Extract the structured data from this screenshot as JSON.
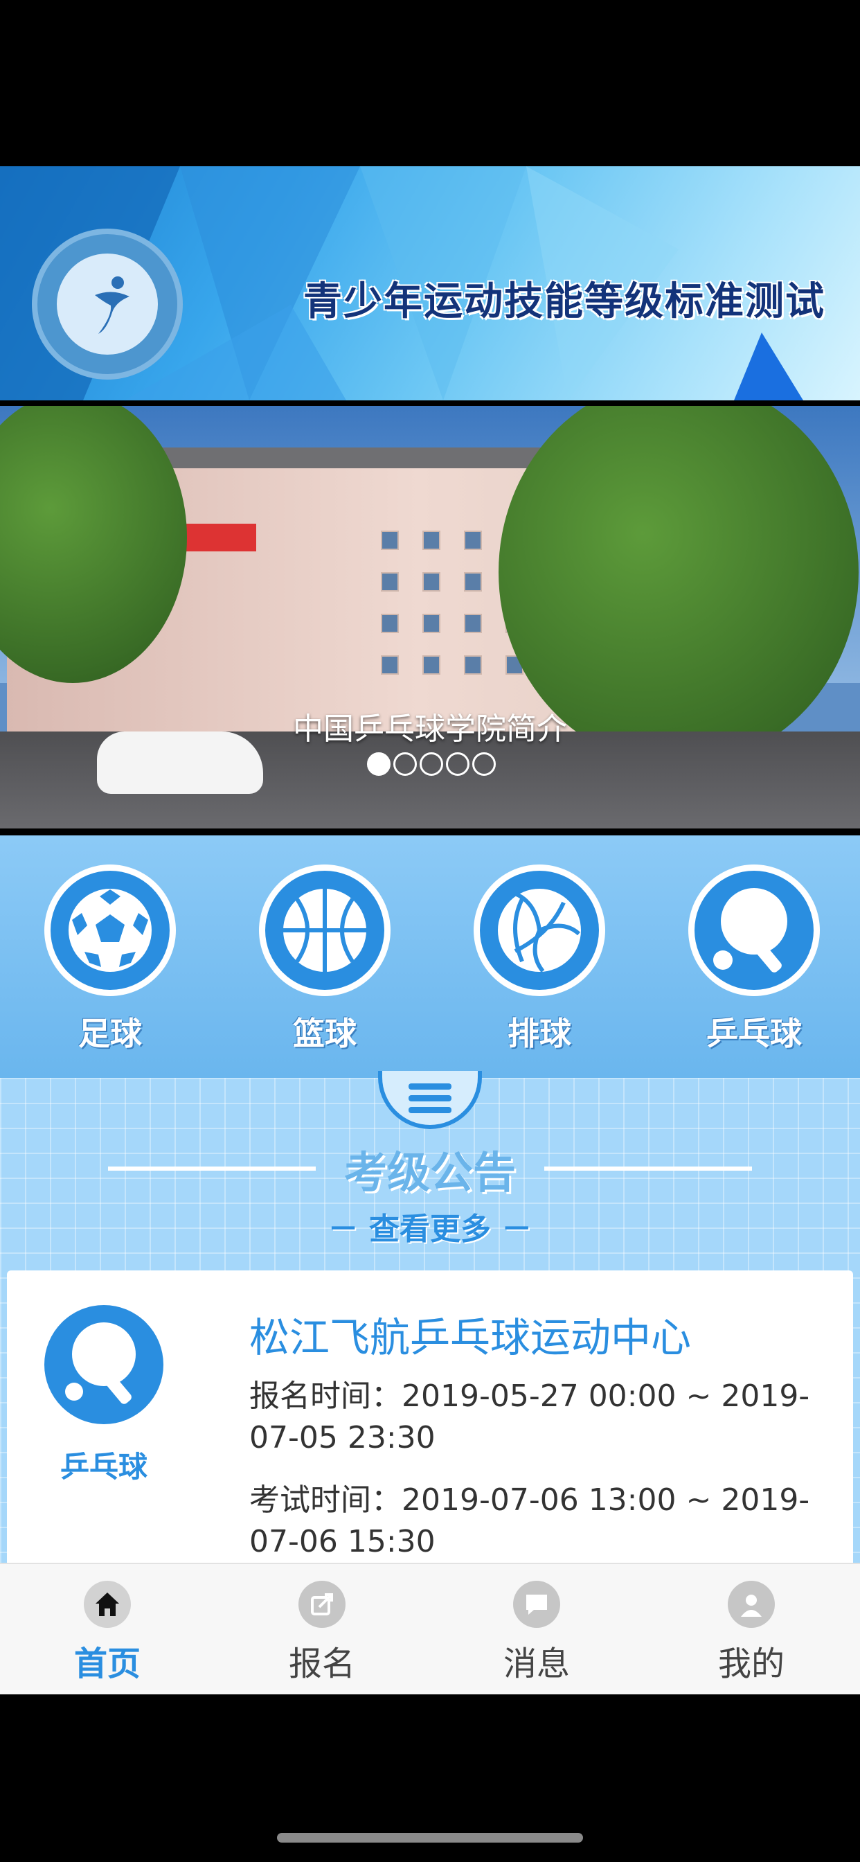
{
  "banner": {
    "title": "青少年运动技能等级标准测试"
  },
  "carousel": {
    "caption": "中国乒乓球学院简介",
    "dot_count": 5,
    "active_dot": 0
  },
  "sports": [
    {
      "label": "足球",
      "icon": "soccer-ball-icon"
    },
    {
      "label": "篮球",
      "icon": "basketball-icon"
    },
    {
      "label": "排球",
      "icon": "volleyball-icon"
    },
    {
      "label": "乒乓球",
      "icon": "table-tennis-icon"
    }
  ],
  "notice": {
    "heading": "考级公告",
    "more": "－ 查看更多 －",
    "card": {
      "sport": "乒乓球",
      "title": "松江飞航乒乓球运动中心",
      "signup": "报名时间：2019-05-27 00:00 ~ 2019-07-05 23:30",
      "exam": "考试时间：2019-07-06 13:00 ~ 2019-07-06 15:30"
    }
  },
  "tabs": [
    {
      "label": "首页",
      "icon": "home-icon",
      "active": true
    },
    {
      "label": "报名",
      "icon": "signup-icon",
      "active": false
    },
    {
      "label": "消息",
      "icon": "message-icon",
      "active": false
    },
    {
      "label": "我的",
      "icon": "profile-icon",
      "active": false
    }
  ],
  "colors": {
    "accent": "#2a8ee0",
    "sports_bg": "#7cc0f2",
    "notice_bg": "#a5d7fa"
  }
}
